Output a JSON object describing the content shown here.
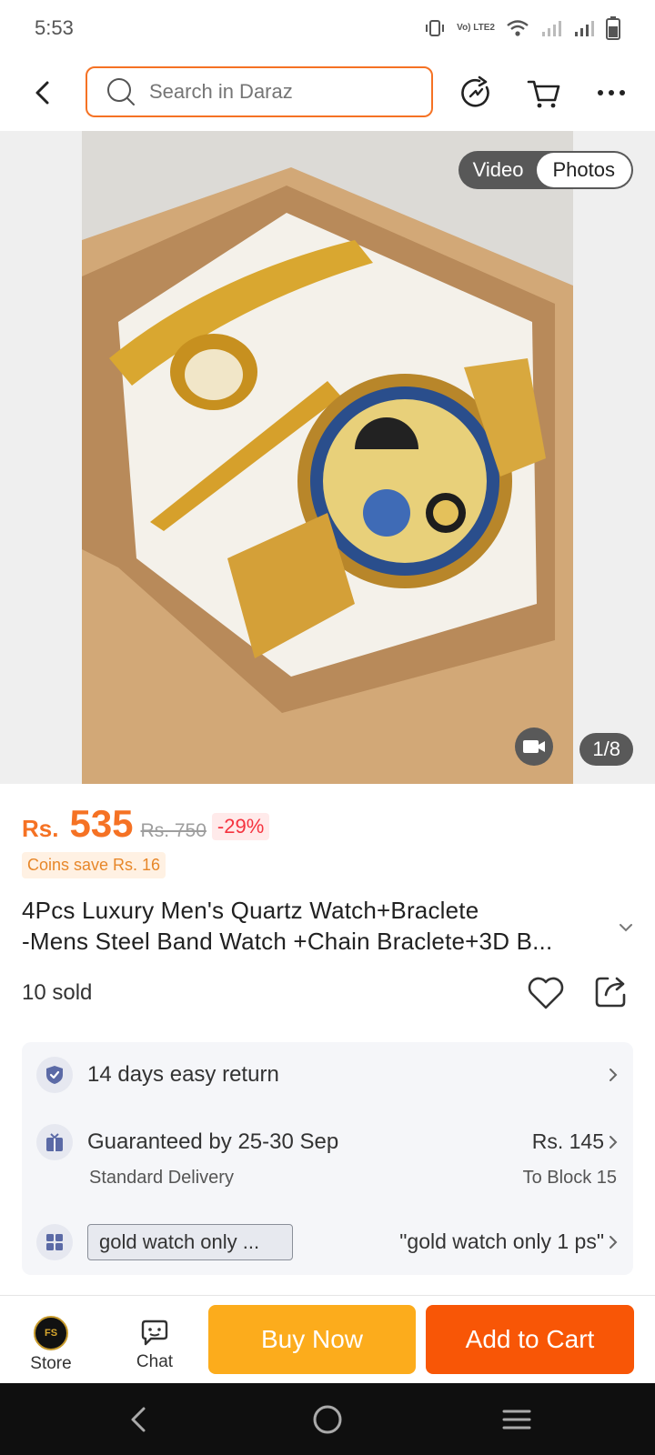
{
  "status_bar": {
    "time": "5:53",
    "lte_label": "Vo) LTE2"
  },
  "header": {
    "search_placeholder": "Search in Daraz"
  },
  "gallery": {
    "toggle_video": "Video",
    "toggle_photos": "Photos",
    "counter": "1/8"
  },
  "price": {
    "currency": "Rs.",
    "value": "535",
    "old_price": "Rs. 750",
    "discount": "-29%",
    "coins": "Coins save Rs. 16"
  },
  "product": {
    "title_line1": "4Pcs Luxury Men's Quartz Watch+Braclete",
    "title_line2": "-Mens Steel Band Watch +Chain Braclete+3D B...",
    "sold": "10 sold"
  },
  "info": {
    "returns": "14 days easy return",
    "delivery_title": "Guaranteed by 25-30 Sep",
    "delivery_type": "Standard Delivery",
    "delivery_fee": "Rs. 145",
    "delivery_location": "To Block 15",
    "variant_chip": "gold watch only ...",
    "variant_selected": "\"gold watch only 1 ps\""
  },
  "bottom_bar": {
    "store_label": "Store",
    "chat_label": "Chat",
    "buy_now": "Buy Now",
    "add_to_cart": "Add to Cart"
  },
  "colors": {
    "brand_orange": "#f57224",
    "buy_now": "#fcac1c",
    "add_to_cart": "#f85606",
    "discount_red": "#f5333f"
  }
}
